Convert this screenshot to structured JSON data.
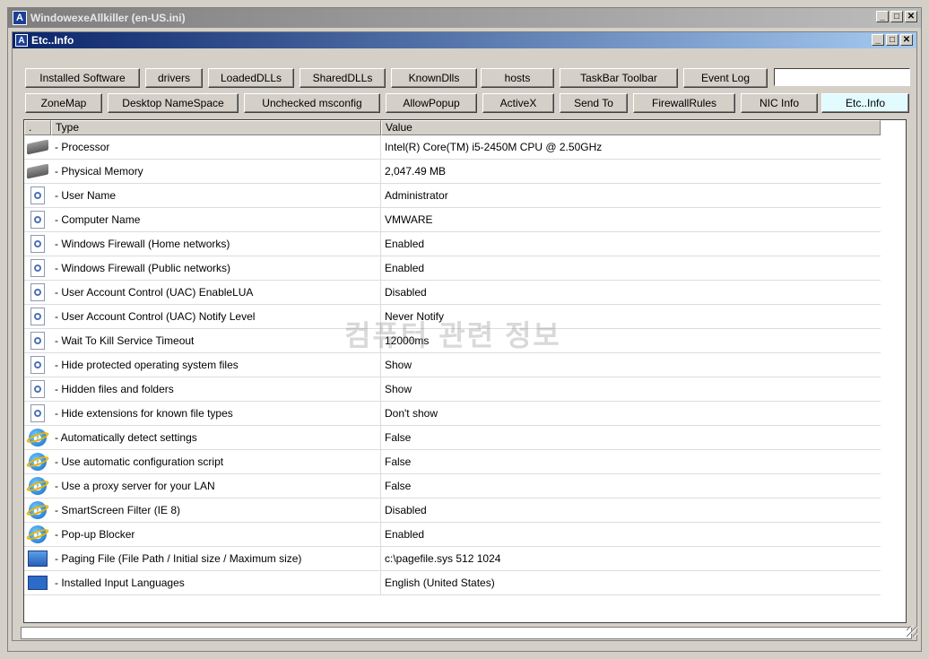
{
  "outer_window": {
    "title": "WindowexeAllkiller (en-US.ini)"
  },
  "inner_window": {
    "title": "Etc..Info"
  },
  "app_icon_letter": "A",
  "toolbar_row1": [
    "Installed Software",
    "drivers",
    "LoadedDLLs",
    "SharedDLLs",
    "KnownDlls",
    "hosts",
    "TaskBar Toolbar",
    "Event Log"
  ],
  "toolbar_row2": [
    "ZoneMap",
    "Desktop NameSpace",
    "Unchecked msconfig",
    "AllowPopup",
    "ActiveX",
    "Send To",
    "FirewallRules",
    "NIC Info",
    "Etc..Info"
  ],
  "active_tab": "Etc..Info",
  "search": {
    "value": ""
  },
  "columns": {
    "c0": ".",
    "c1": "Type",
    "c2": "Value"
  },
  "rows": [
    {
      "icon": "chip-icon",
      "type": "- Processor",
      "value": "Intel(R) Core(TM) i5-2450M CPU @ 2.50GHz"
    },
    {
      "icon": "chip-icon",
      "type": "- Physical Memory",
      "value": "2,047.49 MB"
    },
    {
      "icon": "doc-icon",
      "type": "- User Name",
      "value": "Administrator"
    },
    {
      "icon": "doc-icon",
      "type": "- Computer Name",
      "value": "VMWARE"
    },
    {
      "icon": "doc-icon",
      "type": "- Windows Firewall (Home networks)",
      "value": "Enabled"
    },
    {
      "icon": "doc-icon",
      "type": "- Windows Firewall (Public networks)",
      "value": "Enabled"
    },
    {
      "icon": "doc-icon",
      "type": "- User Account Control (UAC) EnableLUA",
      "value": "Disabled"
    },
    {
      "icon": "doc-icon",
      "type": "- User Account Control (UAC) Notify Level",
      "value": "Never Notify"
    },
    {
      "icon": "doc-icon",
      "type": "- Wait To Kill Service Timeout",
      "value": "12000ms"
    },
    {
      "icon": "doc-icon",
      "type": "- Hide protected operating system files",
      "value": "Show"
    },
    {
      "icon": "doc-icon",
      "type": "- Hidden files and folders",
      "value": "Show"
    },
    {
      "icon": "doc-icon",
      "type": "- Hide extensions for known file types",
      "value": "Don't show"
    },
    {
      "icon": "ie-icon",
      "type": "- Automatically detect settings",
      "value": "False"
    },
    {
      "icon": "ie-icon",
      "type": "- Use automatic configuration script",
      "value": "False"
    },
    {
      "icon": "ie-icon",
      "type": "- Use a proxy server for your LAN",
      "value": "False"
    },
    {
      "icon": "ie-icon",
      "type": "- SmartScreen Filter (IE 8)",
      "value": "Disabled"
    },
    {
      "icon": "ie-icon",
      "type": "- Pop-up Blocker",
      "value": "Enabled"
    },
    {
      "icon": "pagefile-icon",
      "type": "- Paging File (File Path / Initial size / Maximum size)",
      "value": "c:\\pagefile.sys 512 1024"
    },
    {
      "icon": "language-icon",
      "type": "- Installed Input Languages",
      "value": "English (United States)"
    }
  ],
  "watermark": "컴퓨터 관련 정보"
}
